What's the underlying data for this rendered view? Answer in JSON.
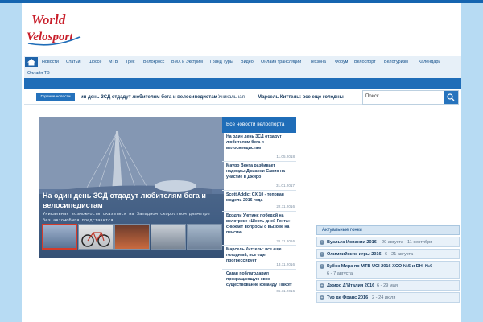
{
  "logo": {
    "line1": "World",
    "line2": "Velosport"
  },
  "nav": {
    "items": [
      "Новости",
      "Статьи",
      "Шоссе",
      "МТВ",
      "Трек",
      "Велокросс",
      "ВМХ и Экстрим",
      "Гранд Туры",
      "Видео",
      "Онлайн трансляции",
      "Техзона",
      "Форум",
      "Велоспорт",
      "Велотуризм",
      "Календарь",
      "Онлайн ТВ"
    ]
  },
  "ticker": {
    "label": "Горячие новости",
    "items": [
      "ин день ЗСД отдадут любителям бега и велосипедистам",
      "» Уникальная",
      "Марсель Киттель: все еще голодны"
    ]
  },
  "search": {
    "placeholder": "Поиск..."
  },
  "slider": {
    "title": "На один день ЗСД отдадут любителям бега и велосипедистам",
    "description": "Уникальная возможность оказаться на Западном скоростном диаметре без автомобиля представится ..."
  },
  "news": {
    "header": "Все новости велоспорта",
    "items": [
      {
        "title": "На один день ЗСД отдадут любителям бега и велосипедистам",
        "date": "11.05.2018"
      },
      {
        "title": "Мауро Вента разбивает надежды Джианни Савио на участие в Джиро",
        "date": "31.01.2017"
      },
      {
        "title": "Scott Addict CX 10 - топовая модель 2016 года",
        "date": "22.11.2016"
      },
      {
        "title": "Брэдли Уиггинс победой на велотреке «Шесть дней Гента» снижает вопросы о вызове на пенсию",
        "date": "21.11.2016"
      },
      {
        "title": "Марсель Киттель: все еще голодный, все еще прогрессирует",
        "date": "13.11.2016"
      },
      {
        "title": "Саган поблагодарил прекращающую свое существование команду Tinkoff",
        "date": "05.11.2016"
      }
    ]
  },
  "races": {
    "header": "Актуальные гонки",
    "items": [
      {
        "name": "Вуэльта Испании 2016",
        "date": "20 августа - 11 сентября"
      },
      {
        "name": "Олимпийские игры 2016",
        "date": "6 - 21 августа"
      },
      {
        "name": "Кубок Мира по МТВ UCI 2016 XCO №5 и DHI №6",
        "date": "6 - 7 августа"
      },
      {
        "name": "Джиро Д'Италия 2016",
        "date": "6 - 29 мая"
      },
      {
        "name": "Тур де Франс 2016",
        "date": "2 - 24 июля"
      }
    ]
  },
  "colors": {
    "accent": "#1f6db8",
    "page_bg": "#b7dbf3",
    "logo_red": "#c81e2a"
  }
}
